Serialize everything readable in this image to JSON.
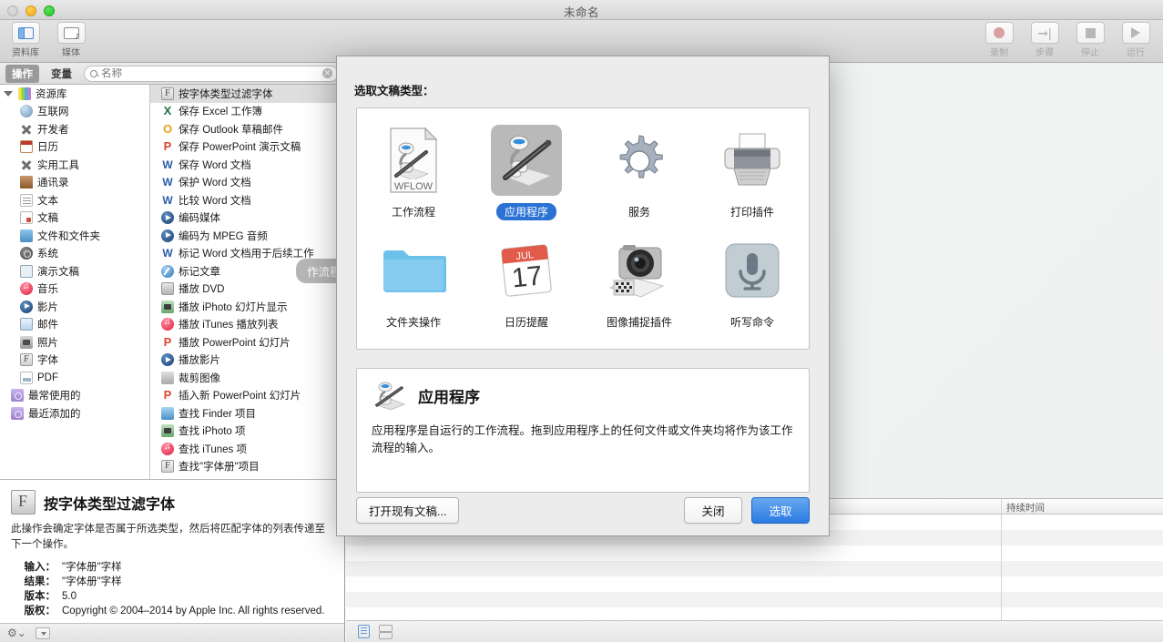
{
  "window": {
    "title": "未命名",
    "traffic_lights": [
      "close-disabled",
      "minimize",
      "zoom"
    ]
  },
  "toolbar": {
    "left": [
      {
        "label": "资料库",
        "icon": "sidebar-toggle-icon"
      },
      {
        "label": "媒体",
        "icon": "media-icon"
      }
    ],
    "right": [
      {
        "label": "录制",
        "icon": "record-icon"
      },
      {
        "label": "步骤",
        "icon": "step-icon"
      },
      {
        "label": "停止",
        "icon": "stop-icon"
      },
      {
        "label": "运行",
        "icon": "run-icon"
      }
    ]
  },
  "library": {
    "segments": {
      "actions": "操作",
      "variables": "变量",
      "active": "操作"
    },
    "search": {
      "value": "",
      "placeholder": "名称"
    },
    "categories_header": "资源库",
    "categories": [
      {
        "label": "互联网",
        "icon": "globe-icon"
      },
      {
        "label": "开发者",
        "icon": "x-cross-icon"
      },
      {
        "label": "日历",
        "icon": "calendar-icon"
      },
      {
        "label": "实用工具",
        "icon": "x-cross-icon"
      },
      {
        "label": "通讯录",
        "icon": "contacts-book-icon"
      },
      {
        "label": "文本",
        "icon": "text-icon"
      },
      {
        "label": "文稿",
        "icon": "document-icon"
      },
      {
        "label": "文件和文件夹",
        "icon": "folder-blue-icon"
      },
      {
        "label": "系统",
        "icon": "system-icon"
      },
      {
        "label": "演示文稿",
        "icon": "presentation-icon"
      },
      {
        "label": "音乐",
        "icon": "music-icon"
      },
      {
        "label": "影片",
        "icon": "quicktime-icon"
      },
      {
        "label": "邮件",
        "icon": "mail-icon"
      },
      {
        "label": "照片",
        "icon": "photos-icon"
      },
      {
        "label": "字体",
        "icon": "font-book-icon"
      },
      {
        "label": "PDF",
        "icon": "pdf-icon"
      }
    ],
    "smart_groups": [
      {
        "label": "最常使用的",
        "icon": "smart-folder-icon"
      },
      {
        "label": "最近添加的",
        "icon": "smart-folder-icon"
      }
    ],
    "actions": [
      {
        "label": "按字体类型过滤字体",
        "icon": "font-book-icon",
        "selected": true
      },
      {
        "label": "保存 Excel 工作簿",
        "icon": "excel-icon",
        "selected": false
      },
      {
        "label": "保存 Outlook 草稿邮件",
        "icon": "outlook-icon",
        "selected": false
      },
      {
        "label": "保存 PowerPoint 演示文稿",
        "icon": "powerpoint-icon",
        "selected": false
      },
      {
        "label": "保存 Word 文档",
        "icon": "word-icon",
        "selected": false
      },
      {
        "label": "保护 Word 文档",
        "icon": "word-icon",
        "selected": false
      },
      {
        "label": "比较 Word 文档",
        "icon": "word-icon",
        "selected": false
      },
      {
        "label": "编码媒体",
        "icon": "quicktime-icon",
        "selected": false
      },
      {
        "label": "编码为 MPEG 音频",
        "icon": "quicktime-icon",
        "selected": false
      },
      {
        "label": "标记 Word 文档用于后续工作",
        "icon": "word-icon",
        "selected": false
      },
      {
        "label": "标记文章",
        "icon": "safari-icon",
        "selected": false
      },
      {
        "label": "播放 DVD",
        "icon": "dvd-icon",
        "selected": false
      },
      {
        "label": "播放 iPhoto 幻灯片显示",
        "icon": "iphoto-icon",
        "selected": false
      },
      {
        "label": "播放 iTunes 播放列表",
        "icon": "itunes-icon",
        "selected": false
      },
      {
        "label": "播放 PowerPoint 幻灯片",
        "icon": "powerpoint-icon",
        "selected": false
      },
      {
        "label": "播放影片",
        "icon": "quicktime-icon",
        "selected": false
      },
      {
        "label": "裁剪图像",
        "icon": "crop-icon",
        "selected": false
      },
      {
        "label": "插入新 PowerPoint 幻灯片",
        "icon": "powerpoint-icon",
        "selected": false
      },
      {
        "label": "查找 Finder 项目",
        "icon": "finder-icon",
        "selected": false
      },
      {
        "label": "查找 iPhoto 项",
        "icon": "iphoto-icon",
        "selected": false
      },
      {
        "label": "查找 iTunes 项",
        "icon": "itunes-icon",
        "selected": false
      },
      {
        "label": "查找\"字体册\"项目",
        "icon": "font-book-icon",
        "selected": false
      }
    ],
    "info": {
      "title": "按字体类型过滤字体",
      "icon": "font-book-icon",
      "description": "此操作会确定字体是否属于所选类型，然后将匹配字体的列表传递至下一个操作。",
      "fields": [
        {
          "key": "输入：",
          "value": "\"字体册\"字样"
        },
        {
          "key": "结果：",
          "value": "\"字体册\"字样"
        },
        {
          "key": "版本：",
          "value": "5.0"
        },
        {
          "key": "版权：",
          "value": "Copyright © 2004–2014 by Apple Inc. All rights reserved."
        }
      ]
    },
    "bottom_bar": {
      "gear": "gear-icon",
      "action_menu": "dropdown-icon"
    }
  },
  "canvas": {
    "hint": "作流程。",
    "log": {
      "duration_column": "持续时间",
      "rows": 8,
      "view_buttons": [
        {
          "name": "log-list-view",
          "active": true
        },
        {
          "name": "log-split-view",
          "active": false
        }
      ]
    }
  },
  "dialog": {
    "prompt": "选取文稿类型：",
    "templates": [
      {
        "label": "工作流程",
        "icon": "workflow-document-icon",
        "selected": false
      },
      {
        "label": "应用程序",
        "icon": "automator-application-icon",
        "selected": true
      },
      {
        "label": "服务",
        "icon": "gear-service-icon",
        "selected": false
      },
      {
        "label": "打印插件",
        "icon": "printer-plugin-icon",
        "selected": false
      },
      {
        "label": "文件夹操作",
        "icon": "folder-action-icon",
        "selected": false
      },
      {
        "label": "日历提醒",
        "icon": "calendar-alarm-icon",
        "selected": false
      },
      {
        "label": "图像捕捉插件",
        "icon": "image-capture-icon",
        "selected": false
      },
      {
        "label": "听写命令",
        "icon": "dictation-microphone-icon",
        "selected": false
      }
    ],
    "selection": {
      "title": "应用程序",
      "icon": "automator-application-icon",
      "description": "应用程序是自运行的工作流程。拖到应用程序上的任何文件或文件夹均将作为该工作流程的输入。"
    },
    "buttons": {
      "open_existing": "打开现有文稿...",
      "close": "关闭",
      "choose": "选取"
    },
    "calendar_icon": {
      "month": "JUL",
      "day": "17"
    },
    "workflow_icon_text": "WFLOW"
  },
  "colors": {
    "accent_blue": "#2a72d4",
    "selection_gray": "#b9b9b9",
    "hint_pill": "#b6b6b6"
  }
}
